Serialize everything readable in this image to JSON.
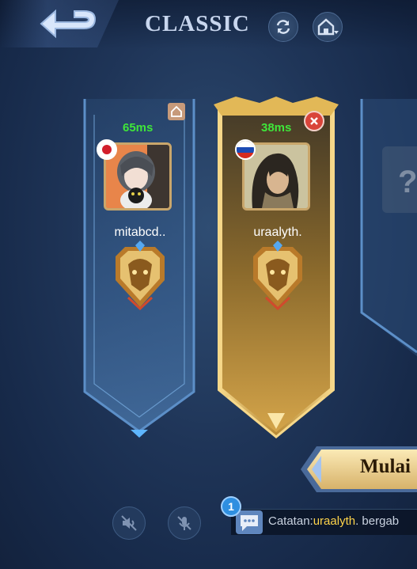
{
  "header": {
    "mode_title": "CLASSIC",
    "back_icon": "back-arrow-icon",
    "refresh_icon": "refresh-icon",
    "home_icon": "home-dropdown-icon"
  },
  "players": [
    {
      "name": "mitabcd..",
      "ping": "65ms",
      "flag": "japan-flag-icon",
      "rank_icon": "rank-emblem-icon",
      "is_host": true,
      "ping_color": "#3fe53a"
    },
    {
      "name": "uraalyth.",
      "ping": "38ms",
      "flag": "russia-flag-icon",
      "rank_icon": "rank-emblem-icon",
      "is_self": true,
      "ping_color": "#3fe53a"
    }
  ],
  "actions": {
    "start_label": "Mulai"
  },
  "voice": {
    "speaker_icon": "speaker-muted-icon",
    "mic_icon": "mic-muted-icon"
  },
  "chat": {
    "badge_count": "1",
    "prefix": "Catatan:",
    "user": "uraalyth",
    "suffix": ". bergab"
  },
  "colors": {
    "accent_gold": "#d9a946",
    "ping_green": "#3fe53a",
    "highlight_name": "#ffd44a"
  }
}
